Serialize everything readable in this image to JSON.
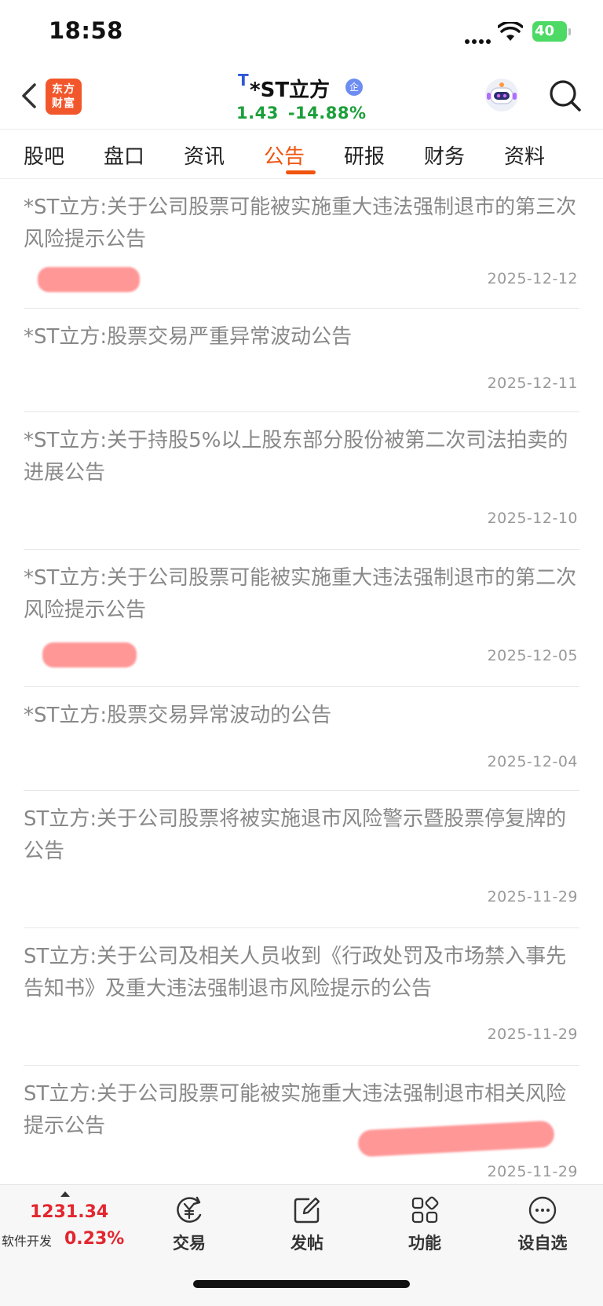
{
  "status_bar": {
    "time": "18:58",
    "battery": "40"
  },
  "header": {
    "logo_line1": "东方",
    "logo_line2": "财富",
    "tag": "T",
    "stock_name": "*ST立方",
    "enterprise_badge": "企",
    "price": "1.43",
    "change_pct": "-14.88%"
  },
  "tabs": [
    {
      "label": "股吧"
    },
    {
      "label": "盘口"
    },
    {
      "label": "资讯"
    },
    {
      "label": "公告",
      "active": true
    },
    {
      "label": "研报"
    },
    {
      "label": "财务"
    },
    {
      "label": "资料"
    }
  ],
  "announcements": [
    {
      "title": "*ST立方:关于公司股票可能被实施重大违法强制退市的第三次风险提示公告",
      "date": "2025-12-12"
    },
    {
      "title": "*ST立方:股票交易严重异常波动公告",
      "date": "2025-12-11"
    },
    {
      "title": "*ST立方:关于持股5%以上股东部分股份被第二次司法拍卖的进展公告",
      "date": "2025-12-10"
    },
    {
      "title": "*ST立方:关于公司股票可能被实施重大违法强制退市的第二次风险提示公告",
      "date": "2025-12-05"
    },
    {
      "title": "*ST立方:股票交易异常波动的公告",
      "date": "2025-12-04"
    },
    {
      "title": "ST立方:关于公司股票将被实施退市风险警示暨股票停复牌的公告",
      "date": "2025-11-29"
    },
    {
      "title": "ST立方:关于公司及相关人员收到《行政处罚及市场禁入事先告知书》及重大违法强制退市风险提示的公告",
      "date": "2025-11-29"
    },
    {
      "title": "ST立方:关于公司股票可能被实施重大违法强制退市相关风险提示公告",
      "date": "2025-11-29"
    }
  ],
  "bottom_nav": {
    "index_value": "1231.34",
    "index_name": "软件开发",
    "index_change": "0.23%",
    "items": [
      {
        "label": "交易",
        "icon": "trade-yen-icon"
      },
      {
        "label": "发帖",
        "icon": "compose-icon"
      },
      {
        "label": "功能",
        "icon": "grid-icon"
      },
      {
        "label": "设自选",
        "icon": "more-dots-icon"
      }
    ]
  }
}
